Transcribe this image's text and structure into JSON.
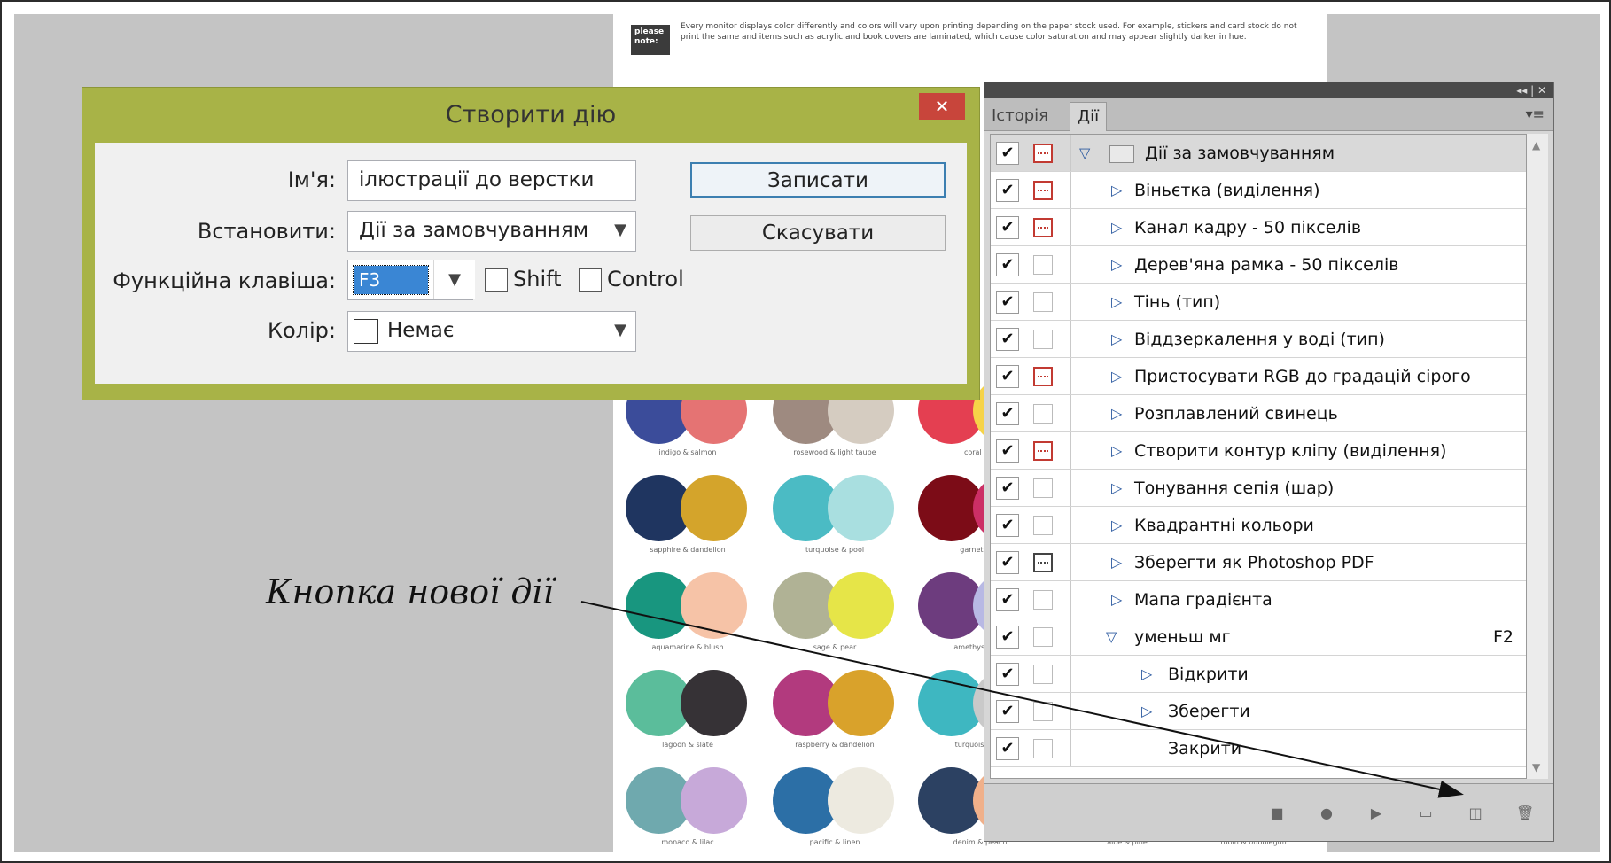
{
  "page_note": {
    "badge": "please note:",
    "text": "Every monitor displays color differently and colors will vary upon printing depending on the paper stock used. For example, stickers and card stock do not print the same and items such as acrylic and book covers are laminated, which cause color saturation and may appear slightly darker in hue."
  },
  "swatches": [
    {
      "label": "indigo & salmon",
      "c1": "#3b4c9a",
      "c2": "#e57373"
    },
    {
      "label": "rosewood & light taupe",
      "c1": "#9e8a80",
      "c2": "#d5ccc1"
    },
    {
      "label": "coral & b",
      "c1": "#e43f51",
      "c2": "#f6d348"
    },
    {
      "label": "sapphire & dandelion",
      "c1": "#1f3560",
      "c2": "#d4a42b"
    },
    {
      "label": "turquoise & pool",
      "c1": "#4bbbc4",
      "c2": "#a9dfe0"
    },
    {
      "label": "garnet & fu",
      "c1": "#7c0c17",
      "c2": "#cc2f66"
    },
    {
      "label": "aquamarine & blush",
      "c1": "#18967f",
      "c2": "#f6c3a7"
    },
    {
      "label": "sage & pear",
      "c1": "#b0b295",
      "c2": "#e6e548"
    },
    {
      "label": "amethyst & pe",
      "c1": "#6d3c7e",
      "c2": "#b8b9e4"
    },
    {
      "label": "lagoon & slate",
      "c1": "#5bbd9b",
      "c2": "#363236"
    },
    {
      "label": "raspberry & dandelion",
      "c1": "#b23a7e",
      "c2": "#d9a22b"
    },
    {
      "label": "turquoise & ...",
      "c1": "#3eb7c1",
      "c2": "#c9c9c9"
    },
    {
      "label": "monaco & lilac",
      "c1": "#6fa9ae",
      "c2": "#c7a9d9"
    },
    {
      "label": "pacific & linen",
      "c1": "#2c6fa6",
      "c2": "#edeae0"
    },
    {
      "label": "denim & peach",
      "c1": "#2c4162",
      "c2": "#f0b08a"
    }
  ],
  "swatch_tail": [
    "aloe & pine",
    "robin & bubblegum"
  ],
  "dialog": {
    "title": "Створити дію",
    "close_symbol": "✕",
    "name_label": "Ім'я:",
    "name_value": "ілюстрації до верстки",
    "set_label": "Встановити:",
    "set_value": "Дії за замовчуванням",
    "fkey_label": "Функційна клавіша:",
    "fkey_value": "F3",
    "shift_label": "Shift",
    "control_label": "Control",
    "color_label": "Колір:",
    "color_value": "Немає",
    "record_button": "Записати",
    "cancel_button": "Скасувати"
  },
  "panel": {
    "top_icons": "◂◂ | ✕",
    "tabs": [
      {
        "label": "Історія",
        "active": false
      },
      {
        "label": "Дії",
        "active": true
      }
    ],
    "menu_icon": "▾≡",
    "rows": [
      {
        "label": "Дії за замовчуванням",
        "level": 0,
        "type": "folder",
        "expanded": true,
        "dlg": "on",
        "key": ""
      },
      {
        "label": "Віньєтка (виділення)",
        "level": 1,
        "type": "action",
        "expanded": false,
        "dlg": "on",
        "key": ""
      },
      {
        "label": "Канал кадру - 50 пікселів",
        "level": 1,
        "type": "action",
        "expanded": false,
        "dlg": "on",
        "key": ""
      },
      {
        "label": "Дерев'яна рамка - 50 пікселів",
        "level": 1,
        "type": "action",
        "expanded": false,
        "dlg": "off",
        "key": ""
      },
      {
        "label": "Тінь (тип)",
        "level": 1,
        "type": "action",
        "expanded": false,
        "dlg": "off",
        "key": ""
      },
      {
        "label": "Віддзеркалення у воді (тип)",
        "level": 1,
        "type": "action",
        "expanded": false,
        "dlg": "off",
        "key": ""
      },
      {
        "label": "Пристосувати RGB до градацій сірого",
        "level": 1,
        "type": "action",
        "expanded": false,
        "dlg": "on",
        "key": ""
      },
      {
        "label": "Розплавлений свинець",
        "level": 1,
        "type": "action",
        "expanded": false,
        "dlg": "off",
        "key": ""
      },
      {
        "label": "Створити контур кліпу (виділення)",
        "level": 1,
        "type": "action",
        "expanded": false,
        "dlg": "on",
        "key": ""
      },
      {
        "label": "Тонування сепія (шар)",
        "level": 1,
        "type": "action",
        "expanded": false,
        "dlg": "off",
        "key": ""
      },
      {
        "label": "Квадрантні кольори",
        "level": 1,
        "type": "action",
        "expanded": false,
        "dlg": "off",
        "key": ""
      },
      {
        "label": "Зберегти як Photoshop PDF",
        "level": 1,
        "type": "action",
        "expanded": false,
        "dlg": "grey",
        "key": ""
      },
      {
        "label": "Мапа градієнта",
        "level": 1,
        "type": "action",
        "expanded": false,
        "dlg": "off",
        "key": ""
      },
      {
        "label": "уменьш мг",
        "level": 1,
        "type": "action",
        "expanded": true,
        "dlg": "off",
        "key": "F2"
      },
      {
        "label": "Відкрити",
        "level": 2,
        "type": "step",
        "expanded": false,
        "dlg": "off",
        "key": ""
      },
      {
        "label": "Зберегти",
        "level": 2,
        "type": "step",
        "expanded": false,
        "dlg": "off",
        "key": ""
      },
      {
        "label": "Закрити",
        "level": 2,
        "type": "step-leaf",
        "expanded": false,
        "dlg": "off",
        "key": ""
      }
    ],
    "bottom_icons": [
      {
        "name": "stop-icon",
        "glyph": "■"
      },
      {
        "name": "record-icon",
        "glyph": "●"
      },
      {
        "name": "play-icon",
        "glyph": "▶"
      },
      {
        "name": "new-set-folder-icon",
        "glyph": "▭"
      },
      {
        "name": "new-action-icon",
        "glyph": "◫"
      },
      {
        "name": "delete-trash-icon",
        "glyph": "🗑"
      }
    ]
  },
  "annotation": {
    "text": "Кнопка нової дії"
  },
  "colors": {
    "dialog_frame": "#a8b347",
    "close_button": "#c8453b",
    "selection": "#3a86d4",
    "dialog_toggle_red": "#c23a32",
    "tri_blue": "#2c5aa0"
  }
}
